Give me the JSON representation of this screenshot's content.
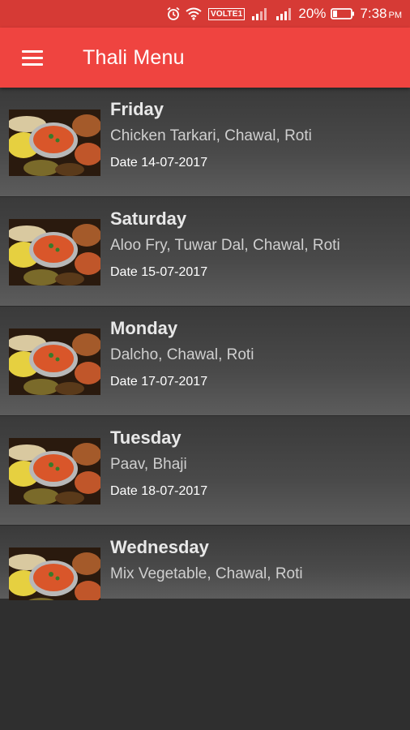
{
  "status_bar": {
    "volte": "VOLTE1",
    "battery_percent": "20%",
    "time": "7:38",
    "meridiem": "PM",
    "icons": [
      "alarm-icon",
      "wifi-icon",
      "signal-icon",
      "signal-icon",
      "battery-icon"
    ]
  },
  "app_bar": {
    "title": "Thali Menu",
    "menu_icon": "hamburger-menu-icon",
    "color": "#ef4440"
  },
  "menu_list": [
    {
      "day": "Friday",
      "items": "Chicken Tarkari, Chawal, Roti",
      "date": "Date 14-07-2017"
    },
    {
      "day": "Saturday",
      "items": "Aloo Fry, Tuwar Dal, Chawal, Roti",
      "date": "Date 15-07-2017"
    },
    {
      "day": "Monday",
      "items": "Dalcho, Chawal, Roti",
      "date": "Date 17-07-2017"
    },
    {
      "day": "Tuesday",
      "items": "Paav, Bhaji",
      "date": "Date 18-07-2017"
    },
    {
      "day": "Wednesday",
      "items": "Mix Vegetable, Chawal, Roti",
      "date": ""
    }
  ]
}
